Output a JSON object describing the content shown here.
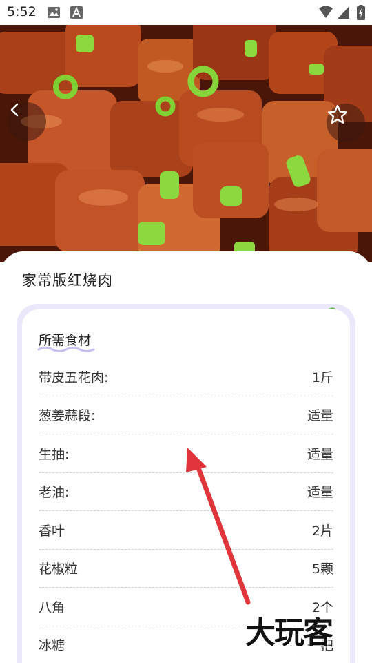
{
  "status_bar": {
    "time": "5:52",
    "icons": [
      "image-icon",
      "a-notification-icon",
      "wifi-icon",
      "signal-icon",
      "battery-charging-icon"
    ]
  },
  "hero": {
    "image": "braised-pork-photo",
    "back_icon": "chevron-left-icon",
    "favorite_icon": "star-outline-icon"
  },
  "recipe": {
    "title": "家常版红烧肉"
  },
  "ingredients": {
    "title": "所需食材",
    "decoration_icon": "pasta-bowl-icon",
    "accent_color": "#ece8fb",
    "items": [
      {
        "name": "带皮五花肉:",
        "amount": "1斤"
      },
      {
        "name": "葱姜蒜段:",
        "amount": "适量"
      },
      {
        "name": "生抽:",
        "amount": "适量"
      },
      {
        "name": "老油:",
        "amount": "适量"
      },
      {
        "name": "香叶",
        "amount": "2片"
      },
      {
        "name": "花椒粒",
        "amount": "5颗"
      },
      {
        "name": "八角",
        "amount": "2个"
      },
      {
        "name": "冰糖",
        "amount": "一把"
      }
    ]
  },
  "overlay": {
    "arrow_color": "#e0353a",
    "watermark": "大玩客"
  }
}
